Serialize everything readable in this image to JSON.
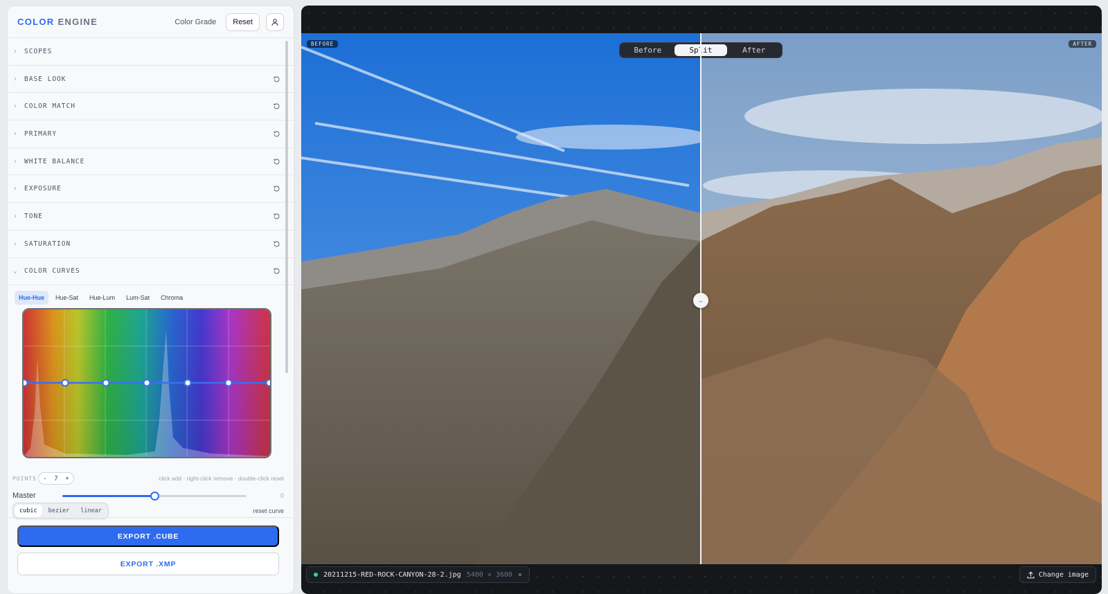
{
  "header": {
    "brand_primary": "COLOR",
    "brand_secondary": "ENGINE",
    "mode": "Color Grade",
    "reset_label": "Reset",
    "user_icon": "user-icon"
  },
  "sections": [
    {
      "label": "SCOPES",
      "resettable": false
    },
    {
      "label": "BASE LOOK",
      "resettable": true
    },
    {
      "label": "COLOR MATCH",
      "resettable": true
    },
    {
      "label": "PRIMARY",
      "resettable": true
    },
    {
      "label": "WHITE BALANCE",
      "resettable": true
    },
    {
      "label": "EXPOSURE",
      "resettable": true
    },
    {
      "label": "TONE",
      "resettable": true
    },
    {
      "label": "SATURATION",
      "resettable": true
    },
    {
      "label": "COLOR CURVES",
      "resettable": true,
      "expanded": true
    }
  ],
  "curves": {
    "tabs": [
      "Hue-Hue",
      "Hue-Sat",
      "Hue-Lum",
      "Lum-Sat",
      "Chroma"
    ],
    "active_tab": "Hue-Hue",
    "points_label": "POINTS",
    "points_count": "7",
    "minus": "-",
    "plus": "+",
    "hint": "click add · right-click remove · double-click reset",
    "master_label": "Master",
    "master_value": "0",
    "master_level": 0.5,
    "interp": [
      "cubic",
      "bezier",
      "linear"
    ],
    "active_interp": "cubic",
    "reset_curve": "reset curve",
    "accent": "#2d6cf0"
  },
  "export": {
    "cube": "EXPORT .CUBE",
    "xmp": "EXPORT .XMP"
  },
  "viewer": {
    "before_tag": "BEFORE",
    "after_tag": "AFTER",
    "modes": [
      "Before",
      "Split",
      "After"
    ],
    "active_mode": "Split",
    "filename": "20211215-RED-ROCK-CANYON-28-2.jpg",
    "dimensions": "5400 × 3600",
    "close": "×",
    "change_label": "Change image",
    "split_handle": "↔"
  }
}
